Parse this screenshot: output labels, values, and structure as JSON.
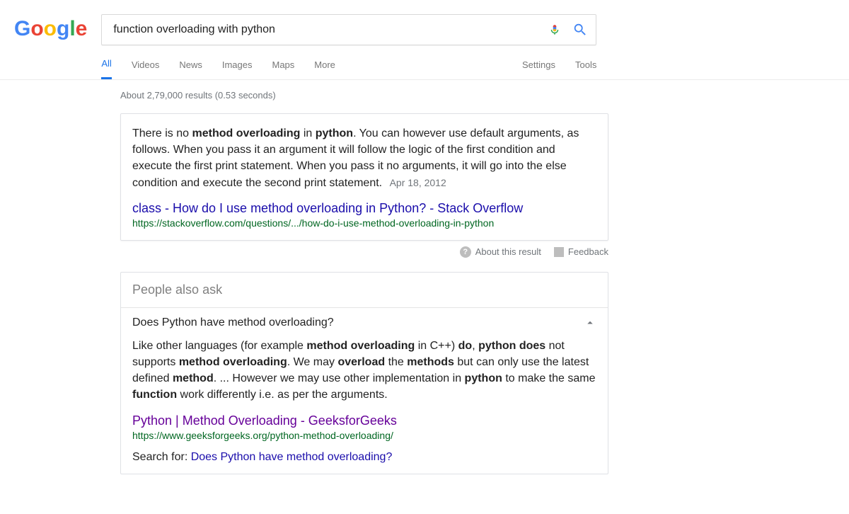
{
  "logo": {
    "letters": [
      "G",
      "o",
      "o",
      "g",
      "l",
      "e"
    ]
  },
  "search": {
    "query": "function overloading with python"
  },
  "tabs": [
    "All",
    "Videos",
    "News",
    "Images",
    "Maps",
    "More"
  ],
  "tabs_active_index": 0,
  "tools": [
    "Settings",
    "Tools"
  ],
  "stats": "About 2,79,000 results (0.53 seconds)",
  "featured": {
    "snippet_pre": "There is no ",
    "b1": "method overloading",
    "mid1": " in ",
    "b2": "python",
    "rest": ". You can however use default arguments, as follows. When you pass it an argument it will follow the logic of the first condition and execute the first print statement. When you pass it no arguments, it will go into the else condition and execute the second print statement.",
    "date": "Apr 18, 2012",
    "title": "class - How do I use method overloading in Python? - Stack Overflow",
    "url": "https://stackoverflow.com/questions/.../how-do-i-use-method-overloading-in-python"
  },
  "meta": {
    "about": "About this result",
    "feedback": "Feedback"
  },
  "paa": {
    "header": "People also ask",
    "q1": "Does Python have method overloading?",
    "body": {
      "t1": "Like other languages (for example ",
      "b1": "method overloading",
      "t2": " in C++) ",
      "b2": "do",
      "t3": ", ",
      "b3": "python does",
      "t4": " not supports ",
      "b4": "method overloading",
      "t5": ". We may ",
      "b5": "overload",
      "t6": " the ",
      "b6": "methods",
      "t7": " but can only use the latest defined ",
      "b7": "method",
      "t8": ". ... However we may use other implementation in ",
      "b8": "python",
      "t9": " to make the same ",
      "b9": "function",
      "t10": " work differently i.e. as per the arguments."
    },
    "title": "Python | Method Overloading - GeeksforGeeks",
    "url": "https://www.geeksforgeeks.org/python-method-overloading/",
    "searchfor_label": "Search for: ",
    "searchfor_link": "Does Python have method overloading?"
  }
}
